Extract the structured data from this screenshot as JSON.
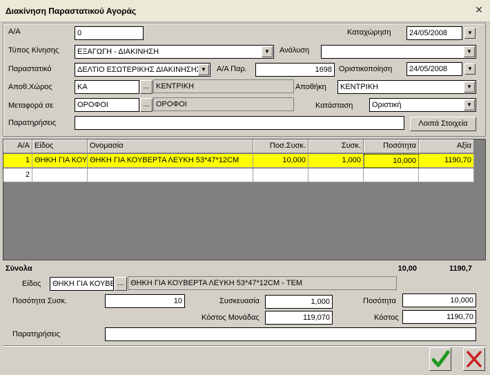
{
  "window": {
    "title": "Διακίνηση Παραστατικού Αγοράς"
  },
  "header": {
    "aa_label": "Α/Α",
    "aa_value": "0",
    "kataxorisi_label": "Καταχώρηση",
    "kataxorisi_value": "24/05/2008",
    "typos_label": "Τύπος Κίνησης",
    "typos_value": "ΕΞΑΓΩΓΗ - ΔΙΑΚΙΝΗΣΗ",
    "analysi_label": "Ανάλυση",
    "analysi_value": "",
    "parastatiko_label": "Παραστατικό",
    "parastatiko_value": "ΔΕΛΤΙΟ ΕΣΩΤΕΡΙΚΗΣ ΔΙΑΚΙΝΗΣΗΣ",
    "aapar_label": "Α/Α Παρ.",
    "aapar_value": "1698",
    "oristikopoiisi_label": "Οριστικοποίηση",
    "oristikopoiisi_value": "24/05/2008",
    "apoth_xoros_label": "Αποθ.Χώρος",
    "apoth_xoros_code": "ΚΑ",
    "apoth_xoros_name": "ΚΕΝΤΡΙΚΗ",
    "apothiki_label": "Αποθήκη",
    "apothiki_value": "ΚΕΝΤΡΙΚΗ",
    "metafora_label": "Μεταφορά σε",
    "metafora_code": "ΟΡΟΦΟΙ",
    "metafora_name": "ΟΡΟΦΟΙ",
    "katastasi_label": "Κατάσταση",
    "katastasi_value": "Οριστική",
    "paratiriseis_label": "Παρατηρήσεις",
    "paratiriseis_value": "",
    "loipa_button": "Λοιπά Στοιχεία",
    "dots": "..."
  },
  "grid": {
    "columns": [
      "Α/Α",
      "Είδος",
      "Ονομασία",
      "Ποσ.Συσκ.",
      "Συσκ.",
      "Ποσότητα",
      "Αξία"
    ],
    "rows": [
      [
        "1",
        "ΘΗΚΗ ΓΙΑ ΚΟΥΕ",
        "ΘΗΚΗ ΓΙΑ ΚΟΥΒΕΡΤΑ  ΛΕΥΚΗ 53*47*12CM",
        "10,000",
        "1,000",
        "10,000",
        "1190,70"
      ],
      [
        "2",
        "",
        "",
        "",
        "",
        "",
        ""
      ]
    ]
  },
  "totals": {
    "label": "Σύνολα",
    "quantity": "10,00",
    "value": "1190,7"
  },
  "detail": {
    "eidos_label": "Είδος",
    "eidos_code": "ΘΗΚΗ ΓΙΑ ΚΟΥΒΕΡ",
    "eidos_name": "ΘΗΚΗ ΓΙΑ ΚΟΥΒΕΡΤΑ  ΛΕΥΚΗ 53*47*12CM - ΤΕΜ",
    "posotita_sysk_label": "Ποσότητα Συσκ.",
    "posotita_sysk_value": "10",
    "syskevasia_label": "Συσκευασία",
    "syskevasia_value": "1,000",
    "posotita_label": "Ποσότητα",
    "posotita_value": "10,000",
    "kostos_monadas_label": "Κόστος Μονάδας",
    "kostos_monadas_value": "119,070",
    "kostos_label": "Κόστος",
    "kostos_value": "1190,70",
    "paratiriseis_label": "Παρατηρήσεις",
    "paratiriseis_value": "",
    "dots": "..."
  },
  "colors": {
    "selected_row": "#ffff00",
    "ok_green": "#1f9a1f",
    "cancel_red": "#c81e1e"
  },
  "icons": {
    "ok": "check-icon",
    "cancel": "x-icon",
    "close": "close-icon",
    "dropdown": "chevron-down-icon"
  }
}
